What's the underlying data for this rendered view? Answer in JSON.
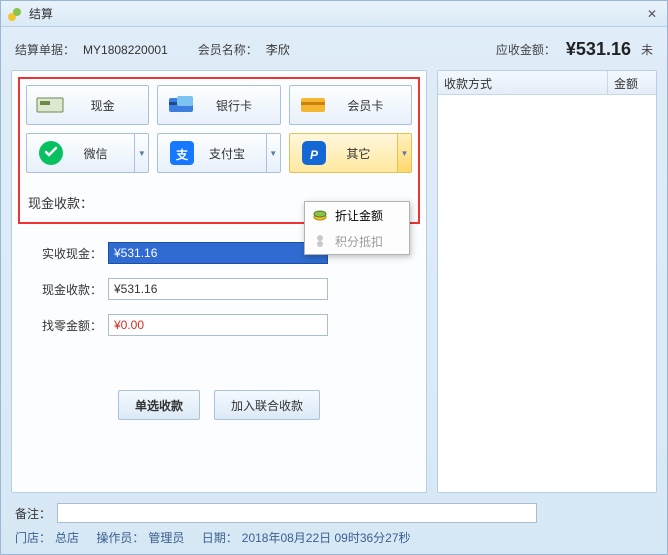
{
  "window": {
    "title": "结算",
    "close_glyph": "✕"
  },
  "header": {
    "order_label": "结算单据：",
    "order_no": "MY1808220001",
    "member_label": "会员名称：",
    "member_name": "李欣",
    "due_label": "应收金额：",
    "due_amount": "¥531.16",
    "tail": "未"
  },
  "payments": {
    "cash": "现金",
    "bank": "银行卡",
    "member": "会员卡",
    "wechat": "微信",
    "alipay": "支付宝",
    "other": "其它"
  },
  "dropdown": {
    "discount": "折让金额",
    "points": "积分抵扣"
  },
  "cash_section_label": "现金收款：",
  "form": {
    "actual_label": "实收现金：",
    "actual_value": "¥531.16",
    "cashpay_label": "现金收款：",
    "cashpay_value": "¥531.16",
    "change_label": "找零金额：",
    "change_value": "¥0.00"
  },
  "actions": {
    "single": "单选收款",
    "join": "加入联合收款"
  },
  "table": {
    "col_method": "收款方式",
    "col_amount": "金额"
  },
  "footer": {
    "remark_label": "备注：",
    "remark_value": "",
    "store_label": "门店：",
    "store_value": "总店",
    "operator_label": "操作员：",
    "operator_value": "管理员",
    "date_label": "日期：",
    "date_value": "2018年08月22日 09时36分27秒"
  },
  "icons": {
    "cash": "cash-icon",
    "bank": "bank-card-icon",
    "member": "member-card-icon",
    "wechat": "wechat-icon",
    "alipay": "alipay-icon",
    "other": "paypal-icon",
    "discount": "coins-icon",
    "points": "points-icon"
  }
}
